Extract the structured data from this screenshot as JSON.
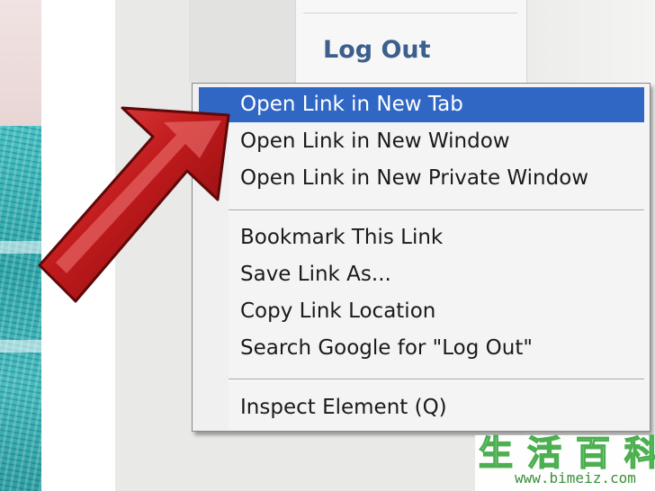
{
  "page": {
    "logout_label": "Log Out"
  },
  "context_menu": {
    "groups": [
      {
        "items": [
          {
            "label": "Open Link in New Tab",
            "active": true
          },
          {
            "label": "Open Link in New Window",
            "active": false
          },
          {
            "label": "Open Link in New Private Window",
            "active": false
          }
        ]
      },
      {
        "items": [
          {
            "label": "Bookmark This Link",
            "active": false
          },
          {
            "label": "Save Link As...",
            "active": false
          },
          {
            "label": "Copy Link Location",
            "active": false
          },
          {
            "label": "Search Google for \"Log Out\"",
            "active": false
          }
        ]
      },
      {
        "items": [
          {
            "label": "Inspect Element (Q)",
            "active": false
          }
        ]
      }
    ],
    "highlight_color": "#3067c5"
  },
  "annotation": {
    "icon": "red-arrow-icon",
    "color": "#b3121a"
  },
  "watermark": {
    "chinese": "生活百科",
    "url": "www.bimeiz.com"
  }
}
